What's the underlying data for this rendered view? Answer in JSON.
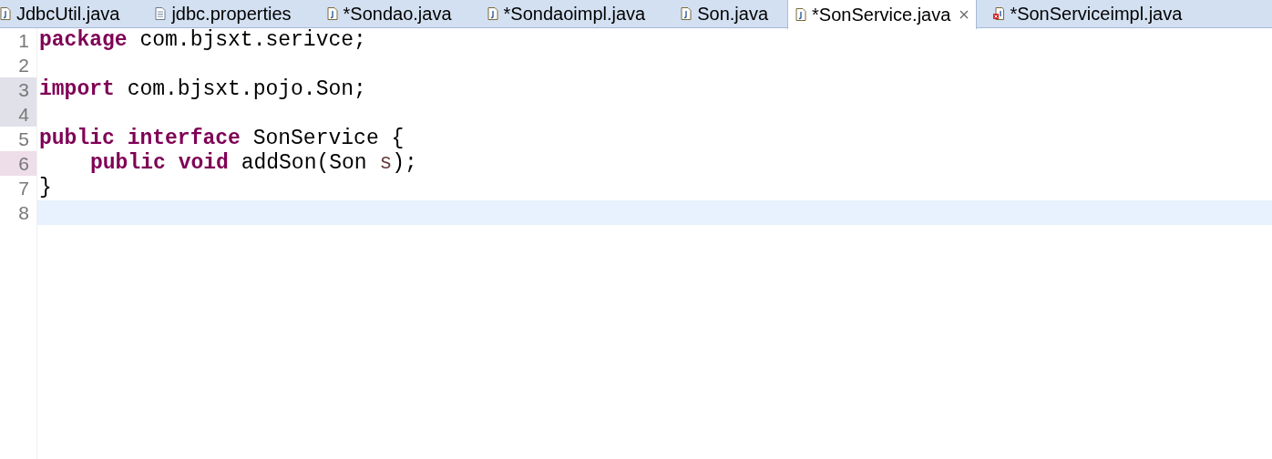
{
  "tabs": [
    {
      "label": "JdbcUtil.java",
      "kind": "java",
      "selected": false
    },
    {
      "label": "jdbc.properties",
      "kind": "text",
      "selected": false
    },
    {
      "label": "*Sondao.java",
      "kind": "java",
      "selected": false
    },
    {
      "label": "*Sondaoimpl.java",
      "kind": "java",
      "selected": false
    },
    {
      "label": "Son.java",
      "kind": "java",
      "selected": false
    },
    {
      "label": "*SonService.java",
      "kind": "java",
      "selected": true
    },
    {
      "label": "*SonServiceimpl.java",
      "kind": "java-error",
      "selected": false
    }
  ],
  "editor": {
    "lines": [
      {
        "number": "1",
        "kind": "plain",
        "tokens": [
          {
            "kind": "keyword",
            "text": "package"
          },
          {
            "kind": "plain",
            "text": "com.bjsxt.serivce;"
          }
        ]
      },
      {
        "number": "2",
        "kind": "plain"
      },
      {
        "number": "3",
        "kind": "changed",
        "tokens": [
          {
            "kind": "keyword",
            "text": "import"
          },
          {
            "kind": "plain",
            "text": "com.bjsxt.pojo.Son;"
          }
        ]
      },
      {
        "number": "4",
        "kind": "changed"
      },
      {
        "number": "5",
        "kind": "plain",
        "tokens": [
          {
            "kind": "keyword",
            "text": "public"
          },
          {
            "kind": "keyword",
            "text": "interface"
          },
          {
            "kind": "plain",
            "text": "SonService {"
          }
        ]
      },
      {
        "number": "6",
        "kind": "added",
        "indented": true,
        "tokens": [
          {
            "kind": "keyword",
            "text": "public"
          },
          {
            "kind": "keyword",
            "text": "void"
          },
          {
            "kind": "plain",
            "text": "addSon(Son"
          },
          {
            "kind": "param",
            "text": "s"
          },
          {
            "kind": "plain",
            "text": ");",
            "attached": true
          }
        ]
      },
      {
        "number": "7",
        "kind": "plain",
        "tokens": [
          {
            "kind": "plain",
            "text": "}"
          }
        ]
      },
      {
        "number": "8",
        "kind": "plain",
        "current": true
      }
    ]
  }
}
